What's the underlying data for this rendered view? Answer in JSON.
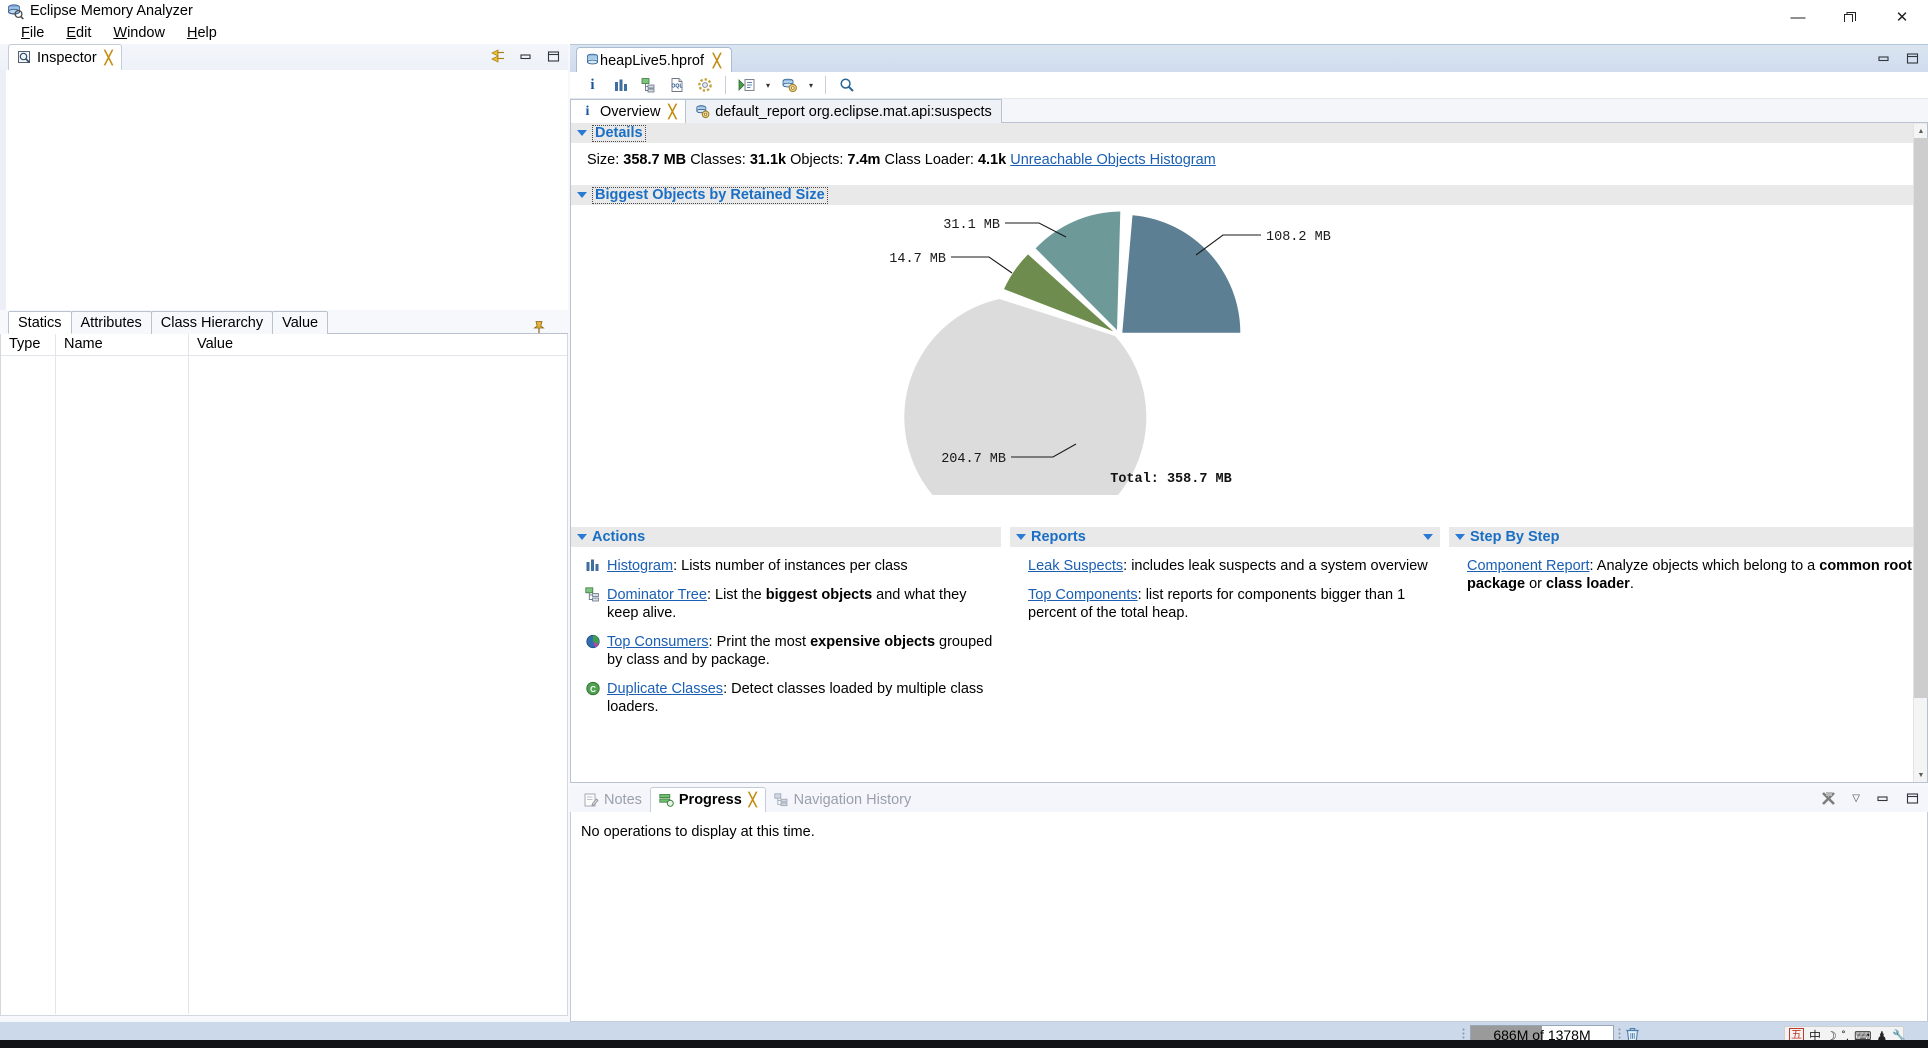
{
  "window": {
    "title": "Eclipse Memory Analyzer",
    "app_icon": "memory-analyzer-icon",
    "minimize": "—",
    "restore": "❐",
    "close": "✕"
  },
  "menubar": {
    "items": [
      {
        "label": "File",
        "mnemonic": "F"
      },
      {
        "label": "Edit",
        "mnemonic": "E"
      },
      {
        "label": "Window",
        "mnemonic": "W"
      },
      {
        "label": "Help",
        "mnemonic": "H"
      }
    ]
  },
  "inspector": {
    "tab_label": "Inspector",
    "tab_icon": "inspector-icon",
    "close_glyph": "╳",
    "toolbar": [
      {
        "name": "link-with-editor-icon"
      },
      {
        "name": "minimize-icon"
      },
      {
        "name": "maximize-icon"
      }
    ],
    "tabs": [
      {
        "label": "Statics",
        "active": true
      },
      {
        "label": "Attributes",
        "active": false
      },
      {
        "label": "Class Hierarchy",
        "active": false
      },
      {
        "label": "Value",
        "active": false
      }
    ],
    "pin_icon": "pin-icon",
    "columns": [
      "Type",
      "Name",
      "Value"
    ],
    "rows": []
  },
  "editor": {
    "tab_label": "heapLive5.hprof",
    "tab_icon": "heap-dump-icon",
    "close_glyph": "╳",
    "minimize_icon": "minimize-icon",
    "maximize_icon": "maximize-icon",
    "toolbar": [
      {
        "name": "overview-info-icon",
        "glyph": "i"
      },
      {
        "name": "histogram-icon"
      },
      {
        "name": "dominator-tree-icon"
      },
      {
        "name": "oql-icon",
        "glyph": "OQL"
      },
      {
        "name": "calculate-retained-size-icon"
      },
      {
        "name": "run-expert-system-test-icon"
      },
      {
        "name": "run-expert-system-test-dropdown",
        "glyph": "▾"
      },
      {
        "name": "open-query-browser-icon"
      },
      {
        "name": "open-query-browser-dropdown",
        "glyph": "▾"
      },
      {
        "name": "find-icon"
      }
    ],
    "subtabs": [
      {
        "label": "Overview",
        "icon": "info-icon",
        "active": true,
        "closable": true
      },
      {
        "label": "default_report  org.eclipse.mat.api:suspects",
        "icon": "report-icon",
        "active": false,
        "closable": false
      }
    ]
  },
  "details": {
    "header": "Details",
    "size_label": "Size:",
    "size_value": "358.7 MB",
    "classes_label": "Classes:",
    "classes_value": "31.1k",
    "objects_label": "Objects:",
    "objects_value": "7.4m",
    "classloader_label": "Class Loader:",
    "classloader_value": "4.1k",
    "unreachable_link": "Unreachable Objects Histogram"
  },
  "biggest_objects": {
    "header": "Biggest Objects by Retained Size"
  },
  "chart_data": {
    "type": "pie",
    "title": "Biggest Objects by Retained Size",
    "total_label": "Total: 358.7 MB",
    "total_value": 358.7,
    "unit": "MB",
    "labels": [
      "108.2 MB",
      "31.1 MB",
      "14.7 MB",
      "204.7 MB"
    ],
    "values": [
      108.2,
      31.1,
      14.7,
      204.7
    ],
    "colors": [
      "#5c7f93",
      "#6d9a99",
      "#6e8c4e",
      "#dcdcdc"
    ],
    "percentages": [
      30.2,
      8.7,
      4.1,
      57.1
    ],
    "exploded": [
      true,
      true,
      true,
      false
    ],
    "legend": "none",
    "grid": false
  },
  "actions": {
    "header": "Actions",
    "items": [
      {
        "icon": "histogram-icon",
        "link": "Histogram",
        "sep": ": ",
        "rest_plain": "Lists number of instances per class"
      },
      {
        "icon": "dominator-tree-icon",
        "link": "Dominator Tree",
        "sep": ": ",
        "rest_a": "List the ",
        "rest_b": "biggest objects",
        "rest_c": " and what they keep alive."
      },
      {
        "icon": "top-consumers-icon",
        "link": "Top Consumers",
        "sep": ": ",
        "rest_a": "Print the most ",
        "rest_b": "expensive objects",
        "rest_c": " grouped by class and by package."
      },
      {
        "icon": "duplicate-classes-icon",
        "link": "Duplicate Classes",
        "sep": ": ",
        "rest_plain": "Detect classes loaded by multiple class loaders."
      }
    ]
  },
  "reports": {
    "header": "Reports",
    "items": [
      {
        "link": "Leak Suspects",
        "sep": ": ",
        "rest_plain": "includes leak suspects and a system overview"
      },
      {
        "link": "Top Components",
        "sep": ": ",
        "rest_plain": "list reports for components bigger than 1 percent of the total heap."
      }
    ]
  },
  "step_by_step": {
    "header": "Step By Step",
    "items": [
      {
        "link": "Component Report",
        "sep": ": ",
        "rest_a": "Analyze objects which belong to a ",
        "rest_b": "common root package",
        "rest_c": " or ",
        "rest_d": "class loader",
        "rest_e": "."
      }
    ]
  },
  "bottom_panel": {
    "tabs": [
      {
        "label": "Notes",
        "icon": "notes-icon",
        "active": false,
        "closable": false
      },
      {
        "label": "Progress",
        "icon": "progress-icon",
        "active": true,
        "closable": true
      },
      {
        "label": "Navigation History",
        "icon": "navigation-history-icon",
        "active": false,
        "closable": false
      }
    ],
    "tools": [
      {
        "name": "cancel-all-icon"
      },
      {
        "name": "view-menu-icon",
        "glyph": "▽"
      },
      {
        "name": "minimize-icon"
      },
      {
        "name": "maximize-icon"
      }
    ],
    "message": "No operations to display at this time."
  },
  "statusbar": {
    "heap_text": "686M of 1378M",
    "heap_used_pct": 50,
    "trash_icon": "trash-icon",
    "tray": [
      {
        "name": "ime-mode-icon",
        "glyph": "五"
      },
      {
        "name": "ime-chinese-icon",
        "glyph": "中"
      },
      {
        "name": "ime-moon-icon",
        "glyph": "☽"
      },
      {
        "name": "ime-punctuation-icon",
        "glyph": "˚,"
      },
      {
        "name": "ime-keyboard-icon",
        "glyph": "⌨"
      },
      {
        "name": "ime-user-icon",
        "glyph": "♟"
      },
      {
        "name": "ime-tools-icon",
        "glyph": "🔧"
      }
    ]
  }
}
